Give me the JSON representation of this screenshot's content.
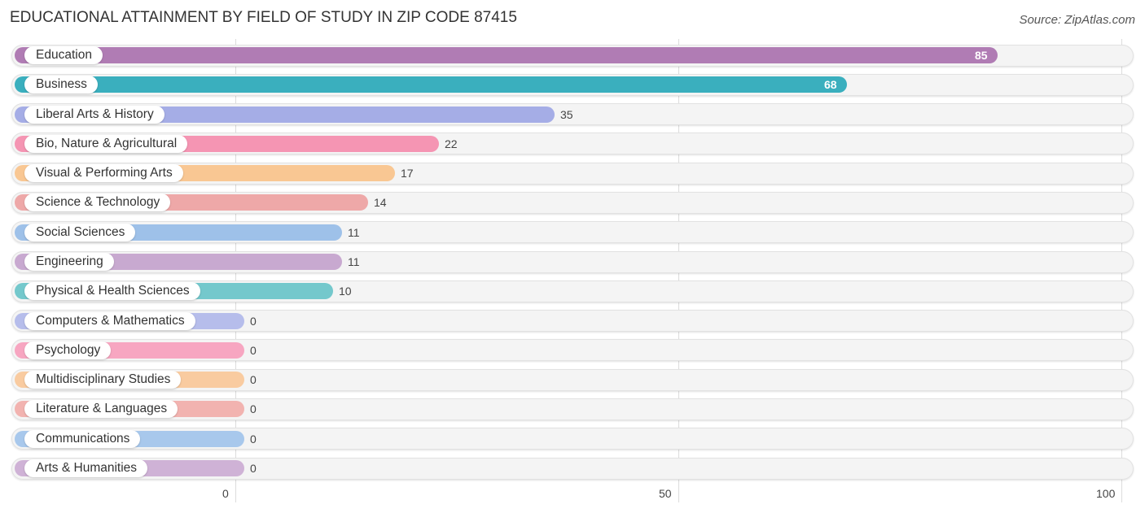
{
  "header": {
    "title": "EDUCATIONAL ATTAINMENT BY FIELD OF STUDY IN ZIP CODE 87415",
    "source": "Source: ZipAtlas.com"
  },
  "chart_data": {
    "type": "bar",
    "orientation": "horizontal",
    "title": "EDUCATIONAL ATTAINMENT BY FIELD OF STUDY IN ZIP CODE 87415",
    "source": "Source: ZipAtlas.com",
    "xlabel": "",
    "ylabel": "",
    "xlim": [
      0,
      100
    ],
    "xticks": [
      0,
      50,
      100
    ],
    "xtick_labels": [
      "0",
      "50",
      "100"
    ],
    "grid": true,
    "categories": [
      "Education",
      "Business",
      "Liberal Arts & History",
      "Bio, Nature & Agricultural",
      "Visual & Performing Arts",
      "Science & Technology",
      "Social Sciences",
      "Engineering",
      "Physical & Health Sciences",
      "Computers & Mathematics",
      "Psychology",
      "Multidisciplinary Studies",
      "Literature & Languages",
      "Communications",
      "Arts & Humanities"
    ],
    "values": [
      85,
      68,
      35,
      22,
      17,
      14,
      11,
      11,
      10,
      0,
      0,
      0,
      0,
      0,
      0
    ],
    "value_labels": [
      "85",
      "68",
      "35",
      "22",
      "17",
      "14",
      "11",
      "11",
      "10",
      "0",
      "0",
      "0",
      "0",
      "0",
      "0"
    ],
    "colors": [
      "#b07cb4",
      "#3aafbe",
      "#a5ade6",
      "#f595b3",
      "#f9c793",
      "#eea8a8",
      "#9ec1e9",
      "#c8a9d0",
      "#74c8cc",
      "#b6bdeb",
      "#f7a6c1",
      "#f9cba0",
      "#f2b3b0",
      "#a8c8ec",
      "#cfb2d6"
    ]
  }
}
